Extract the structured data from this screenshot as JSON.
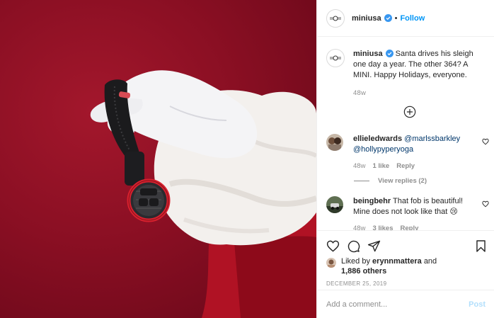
{
  "post": {
    "username": "miniusa",
    "follow_label": "Follow",
    "dot": "•",
    "caption_text": "Santa drives his sleigh one day a year. The other 364? A MINI. Happy Holidays, everyone.",
    "caption_time": "48w",
    "image_alt": "Santa's white-gloved hand holding a MINI key fob"
  },
  "comments": [
    {
      "username": "ellieledwards",
      "text": "@marlssbarkley @hollypyperyoga",
      "time": "48w",
      "likes": "1 like",
      "reply": "Reply",
      "view_replies": "View replies (2)"
    },
    {
      "username": "beingbehr",
      "text": "That fob is beautiful! Mine does not look like that 😢",
      "time": "48w",
      "likes": "3 likes",
      "reply": "Reply"
    }
  ],
  "likes": {
    "prefix": "Liked by",
    "user": "erynnmattera",
    "joiner": "and",
    "count": "1,886 others"
  },
  "date": "DECEMBER 25, 2019",
  "add_comment": {
    "placeholder": "Add a comment...",
    "post_label": "Post"
  },
  "colors": {
    "accent": "#0095f6",
    "mention": "#00376b",
    "muted": "#8e8e8e",
    "post_disabled": "#b2dffc",
    "background_red": "#8a0f23"
  },
  "icons": [
    "verified-badge-icon",
    "plus-circle-icon",
    "heart-icon",
    "comment-icon",
    "share-icon",
    "bookmark-icon"
  ]
}
